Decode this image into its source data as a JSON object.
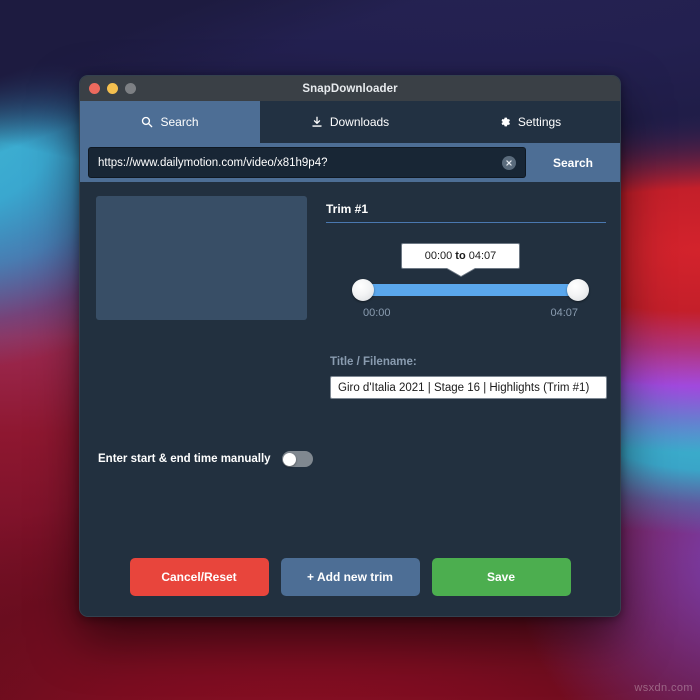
{
  "window": {
    "title": "SnapDownloader",
    "traffic_lights": [
      {
        "name": "close",
        "color": "#ed6a5e"
      },
      {
        "name": "minimize",
        "color": "#f4bf4f"
      },
      {
        "name": "zoom",
        "color": "#7d8084"
      }
    ]
  },
  "tabs": [
    {
      "id": "search",
      "label": "Search",
      "icon": "search-icon",
      "active": true
    },
    {
      "id": "downloads",
      "label": "Downloads",
      "icon": "download-icon",
      "active": false
    },
    {
      "id": "settings",
      "label": "Settings",
      "icon": "gear-icon",
      "active": false
    }
  ],
  "url_bar": {
    "value": "https://www.dailymotion.com/video/x81h9p4?",
    "placeholder": "Paste video URL here",
    "clear_icon": "clear-circle-icon",
    "search_button": "Search"
  },
  "preview": {
    "thumbnail_alt": "video-thumbnail-placeholder"
  },
  "manual_time": {
    "label": "Enter start & end time manually",
    "enabled": false
  },
  "trim": {
    "heading": "Trim #1",
    "tooltip_start": "00:00",
    "tooltip_joiner": "to",
    "tooltip_end": "04:07",
    "range_start_label": "00:00",
    "range_end_label": "04:07",
    "slider_min_percent": 0,
    "slider_max_percent": 100,
    "filename_label": "Title / Filename:",
    "filename_value": "Giro d'Italia 2021 | Stage 16 | Highlights (Trim #1)"
  },
  "footer": {
    "cancel_label": "Cancel/Reset",
    "add_trim_label": "+ Add new trim",
    "save_label": "Save"
  },
  "colors": {
    "accent_blue": "#4d6e95",
    "slider_blue": "#5aa7ed",
    "danger_red": "#e8453c",
    "success_green": "#4cae4f",
    "panel_bg": "#22303f",
    "tabbar_bg": "#223142"
  },
  "watermark": "wsxdn.com"
}
